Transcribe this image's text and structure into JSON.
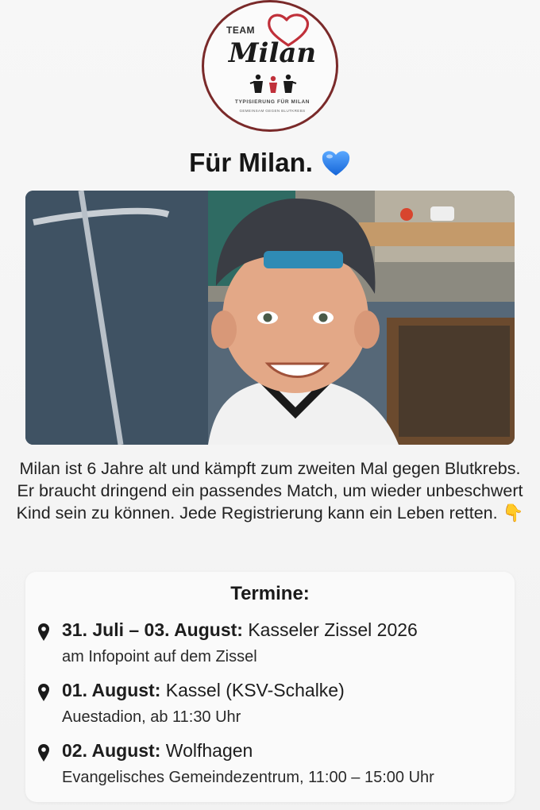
{
  "logo": {
    "team": "TEAM",
    "name": "Milan",
    "slogan": "TYPISIERUNG FÜR MILAN",
    "arc_text": "GEMEINSAM GEGEN BLUTKREBS"
  },
  "headline": {
    "text": "Für Milan.",
    "emoji_icon": "blue-heart-icon"
  },
  "description": {
    "text": "Milan ist 6 Jahre alt und kämpft zum zweiten Mal gegen Blutkrebs. Er braucht dringend ein passendes Match, um wieder unbeschwert Kind sein zu können. Jede Registrierung kann ein Leben retten. 👇"
  },
  "termine": {
    "title": "Termine:",
    "events": [
      {
        "date": "31. Juli – 03. August:",
        "place": "Kasseler Zissel 2026",
        "detail": "am Infopoint auf dem Zissel"
      },
      {
        "date": "01. August:",
        "place": "Kassel (KSV-Schalke)",
        "detail": "Auestadion, ab 11:30 Uhr"
      },
      {
        "date": "02. August:",
        "place": "Wolfhagen",
        "detail": "Evangelisches Gemeindezentrum, 11:00 – 15:00 Uhr"
      }
    ]
  },
  "colors": {
    "brand_dark_red": "#7a2a2a",
    "heart_red": "#c0303a",
    "blue_heart": "#1e7be6",
    "text": "#1f1f1f"
  }
}
